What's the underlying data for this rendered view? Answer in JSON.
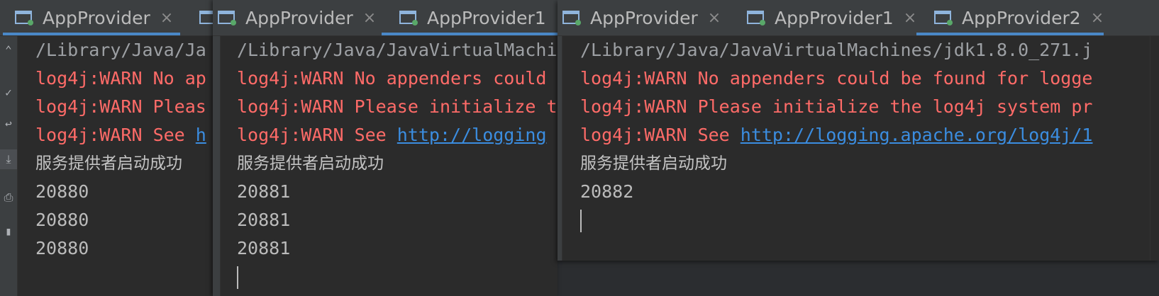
{
  "windows": [
    {
      "tabs": [
        {
          "label": "AppProvider",
          "active": true,
          "close": "×"
        },
        {
          "label": "",
          "active": false,
          "close": ""
        }
      ],
      "console": {
        "path": "/Library/Java/Ja",
        "warn1": "log4j:WARN No ap",
        "warn2": "log4j:WARN Pleas",
        "warn3_prefix": "log4j:WARN See ",
        "warn3_link": "h",
        "started": "服务提供者启动成功",
        "ports": [
          "20880",
          "20880",
          "20880"
        ]
      }
    },
    {
      "tabs": [
        {
          "label": "AppProvider",
          "active": false,
          "close": "×"
        },
        {
          "label": "AppProvider1",
          "active": true,
          "close": "×"
        }
      ],
      "console": {
        "path": "/Library/Java/JavaVirtualMachi",
        "warn1": "log4j:WARN No appenders could",
        "warn2": "log4j:WARN Please initialize t",
        "warn3_prefix": "log4j:WARN See ",
        "warn3_link": "http://logging",
        "started": "服务提供者启动成功",
        "ports": [
          "20881",
          "20881",
          "20881"
        ]
      }
    },
    {
      "tabs": [
        {
          "label": "AppProvider",
          "active": false,
          "close": "×"
        },
        {
          "label": "AppProvider1",
          "active": false,
          "close": "×"
        },
        {
          "label": "AppProvider2",
          "active": true,
          "close": "×"
        }
      ],
      "console": {
        "path": "/Library/Java/JavaVirtualMachines/jdk1.8.0_271.j",
        "warn1": "log4j:WARN No appenders could be found for logge",
        "warn2": "log4j:WARN Please initialize the log4j system pr",
        "warn3_prefix": "log4j:WARN See ",
        "warn3_link": "http://logging.apache.org/log4j/1",
        "started": "服务提供者启动成功",
        "ports": [
          "20882"
        ]
      }
    }
  ],
  "colors": {
    "accent": "#4a88c7",
    "warn": "#ff6b68",
    "link": "#3b8de0",
    "background": "#2b2b2b"
  }
}
